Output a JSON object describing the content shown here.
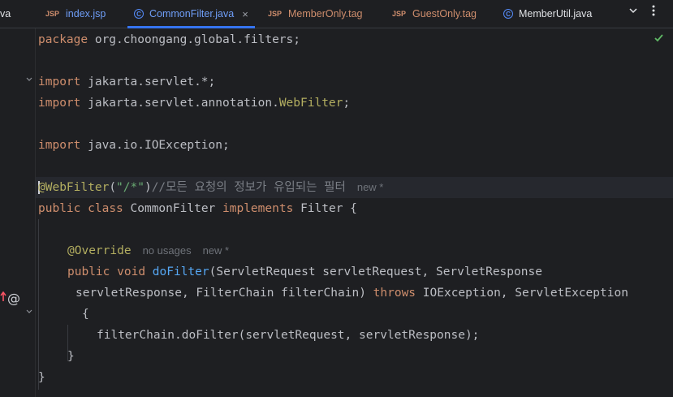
{
  "tabs": [
    {
      "label": "va",
      "kind": "cut"
    },
    {
      "label": "index.jsp",
      "kind": "jsp",
      "badge": "JSP"
    },
    {
      "label": "CommonFilter.java",
      "kind": "class",
      "badge": "C",
      "active": true
    },
    {
      "label": "MemberOnly.tag",
      "kind": "jsp",
      "badge": "JSP"
    },
    {
      "label": "GuestOnly.tag",
      "kind": "jsp",
      "badge": "JSP"
    },
    {
      "label": "MemberUtil.java",
      "kind": "class",
      "badge": "C"
    }
  ],
  "tab_close_glyph": "×",
  "code": {
    "l1_kw": "package",
    "l1_rest": " org.choongang.global.filters;",
    "l3_kw": "import",
    "l3_rest": " jakarta.servlet.*;",
    "l4_kw": "import",
    "l4_rest": " jakarta.servlet.annotation.",
    "l4_ann": "WebFilter",
    "l4_end": ";",
    "l6_kw": "import",
    "l6_rest": " java.io.IOException;",
    "l8_at": "@",
    "l8_ann": "WebFilter",
    "l8_p1": "(",
    "l8_str": "\"/*\"",
    "l8_p2": ")",
    "l8_cmt": "//모든 요청의 정보가 유입되는 필터",
    "l8_hint": "new *",
    "l9_kw1": "public",
    "l9_kw2": "class",
    "l9_name": "CommonFilter",
    "l9_kw3": "implements",
    "l9_rest": "Filter {",
    "l11_ann": "@Override",
    "l11_hint1": "no usages",
    "l11_hint2": "new *",
    "l12_kw1": "public",
    "l12_kw2": "void",
    "l12_fn": "doFilter",
    "l12_rest": "(ServletRequest servletRequest, ServletResponse",
    "l13_a": "servletResponse, FilterChain filterChain) ",
    "l13_kw": "throws",
    "l13_b": " IOException, ServletException",
    "l14": "{",
    "l15": "filterChain.doFilter(servletRequest, servletResponse);",
    "l16": "}",
    "l17": "}"
  }
}
